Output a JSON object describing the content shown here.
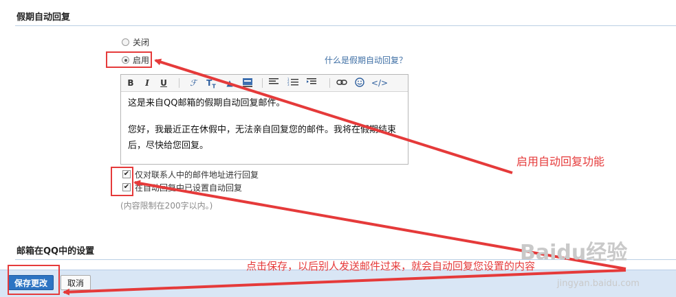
{
  "vacation": {
    "section_title": "假期自动回复",
    "radio_off_label": "关闭",
    "radio_on_label": "启用",
    "help_link": "什么是假期自动回复？",
    "toolbar": {
      "bold": "B",
      "italic": "I",
      "underline": "U",
      "code": "</>"
    },
    "editor_lines": [
      "这是来自QQ邮箱的假期自动回复邮件。",
      "您好，我最近正在休假中，无法亲自回复您的邮件。我将在假期结束后，尽快给您回复。"
    ],
    "checkbox1_label": "仅对联系人中的邮件地址进行回复",
    "checkbox2_label": "在自动回复中已设置自动回复",
    "hint": "(内容限制在200字以内。)"
  },
  "qq_settings": {
    "section_title": "邮箱在QQ中的设置"
  },
  "buttons": {
    "save": "保存更改",
    "cancel": "取消"
  },
  "annotations": {
    "enable_note": "启用自动回复功能",
    "save_note": "点击保存，以后别人发送邮件过来，就会自动回复您设置的内容"
  },
  "watermark": {
    "logo": "Baidu经验",
    "url": "jingyan.baidu.com"
  },
  "colors": {
    "annotation_red": "#e53a3a",
    "primary_button": "#2d74c3",
    "link": "#3f6fa5",
    "divider": "#b9cfe4"
  }
}
